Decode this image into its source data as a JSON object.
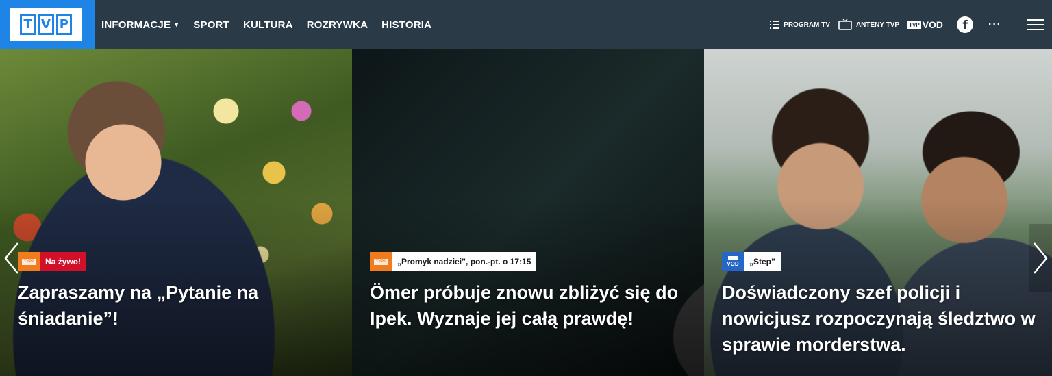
{
  "header": {
    "logo": {
      "letters": [
        "T",
        "V",
        "P"
      ]
    },
    "nav": [
      {
        "label": "INFORMACJE",
        "has_dropdown": true
      },
      {
        "label": "SPORT"
      },
      {
        "label": "KULTURA"
      },
      {
        "label": "ROZRYWKA"
      },
      {
        "label": "HISTORIA"
      }
    ],
    "utility": {
      "program_tv": "PROGRAM TV",
      "anteny_tvp": "ANTENY TVP",
      "vod_small": "TVP",
      "vod": "VOD",
      "facebook": "f",
      "more": "···"
    }
  },
  "slides": [
    {
      "channel": "TVP2",
      "channel_color": "#f07c1e",
      "tag": "Na żywo!",
      "tag_style": "live",
      "headline": "Zapraszamy na „Pytanie na śniadanie”!"
    },
    {
      "channel": "TVP1",
      "channel_color": "#f07c1e",
      "tag": "„Promyk nadziei”, pon.-pt. o 17:15",
      "tag_style": "label",
      "headline": "Ömer próbuje znowu zbliżyć się do Ipek. Wyznaje jej całą prawdę!"
    },
    {
      "channel": "VOD",
      "channel_color": "#2566c8",
      "tag": "„Step”",
      "tag_style": "label",
      "headline": "Doświadczony szef policji i nowicjusz rozpoczynają śledztwo w sprawie morderstwa."
    }
  ],
  "colors": {
    "header_bg": "#2b3a47",
    "logo_bg": "#1e84e6",
    "live_red": "#d3102a"
  }
}
